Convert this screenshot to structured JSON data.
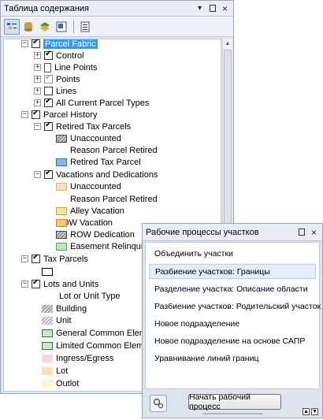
{
  "toc": {
    "title": "Таблица содержания",
    "tree": {
      "parcel_fabric": "Parcel Fabric",
      "control": "Control",
      "line_points": "Line Points",
      "points": "Points",
      "lines": "Lines",
      "all_current": "All Current Parcel Types",
      "parcel_history": "Parcel History",
      "retired_tax": "Retired Tax Parcels",
      "unaccounted_1": "Unaccounted",
      "reason_retired_1": "Reason Parcel Retired",
      "retired_tax_parcel": "Retired Tax Parcel",
      "vacations": "Vacations and Dedications",
      "unaccounted_2": "Unaccounted",
      "reason_retired_2": "Reason Parcel Retired",
      "alley_vacation": "Alley Vacation",
      "row_vacation": "ROW Vacation",
      "row_dedication": "ROW Dedication",
      "easement": "Easement Relinquishment",
      "tax_parcels": "Tax Parcels",
      "lots_units": "Lots and Units",
      "lot_unit_type": "Lot or Unit Type",
      "building": "Building",
      "unit": "Unit",
      "general_common": "General Common Elements",
      "limited_common": "Limited Common Elements",
      "ingress": "Ingress/Egress",
      "lot": "Lot",
      "outlot": "Outlot"
    }
  },
  "workflows": {
    "title": "Рабочие процессы участков",
    "items": [
      "Объединить участки",
      "Разбиение участков: Границы",
      "Разделение участка: Описание области",
      "Разбиение участков: Родительский участок",
      "Новое подразделение",
      "Новое подразделение на основе САПР",
      "Уравнивание линий границ"
    ],
    "start_button": "Начать рабочий процесс"
  }
}
